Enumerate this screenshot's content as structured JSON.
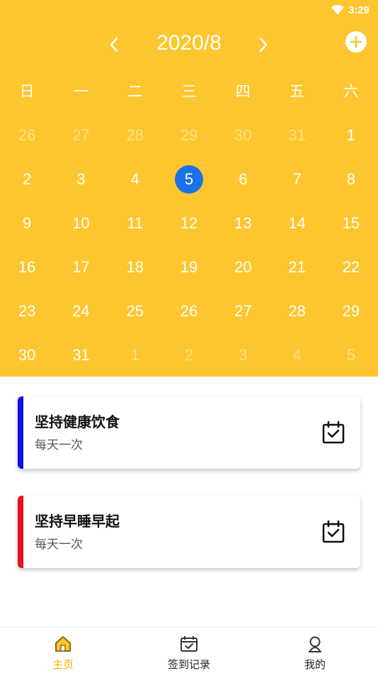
{
  "status_bar": {
    "time": "3:29"
  },
  "calendar": {
    "month_title": "2020/8",
    "weekdays": [
      "日",
      "一",
      "二",
      "三",
      "四",
      "五",
      "六"
    ],
    "days": [
      {
        "label": "26",
        "other": true
      },
      {
        "label": "27",
        "other": true
      },
      {
        "label": "28",
        "other": true
      },
      {
        "label": "29",
        "other": true
      },
      {
        "label": "30",
        "other": true
      },
      {
        "label": "31",
        "other": true
      },
      {
        "label": "1",
        "other": false
      },
      {
        "label": "2",
        "other": false
      },
      {
        "label": "3",
        "other": false
      },
      {
        "label": "4",
        "other": false
      },
      {
        "label": "5",
        "other": false,
        "selected": true
      },
      {
        "label": "6",
        "other": false
      },
      {
        "label": "7",
        "other": false
      },
      {
        "label": "8",
        "other": false
      },
      {
        "label": "9",
        "other": false
      },
      {
        "label": "10",
        "other": false
      },
      {
        "label": "11",
        "other": false
      },
      {
        "label": "12",
        "other": false
      },
      {
        "label": "13",
        "other": false
      },
      {
        "label": "14",
        "other": false
      },
      {
        "label": "15",
        "other": false
      },
      {
        "label": "16",
        "other": false
      },
      {
        "label": "17",
        "other": false
      },
      {
        "label": "18",
        "other": false
      },
      {
        "label": "19",
        "other": false
      },
      {
        "label": "20",
        "other": false
      },
      {
        "label": "21",
        "other": false
      },
      {
        "label": "22",
        "other": false
      },
      {
        "label": "23",
        "other": false
      },
      {
        "label": "24",
        "other": false
      },
      {
        "label": "25",
        "other": false
      },
      {
        "label": "26",
        "other": false
      },
      {
        "label": "27",
        "other": false
      },
      {
        "label": "28",
        "other": false
      },
      {
        "label": "29",
        "other": false
      },
      {
        "label": "30",
        "other": false
      },
      {
        "label": "31",
        "other": false
      },
      {
        "label": "1",
        "other": true
      },
      {
        "label": "2",
        "other": true
      },
      {
        "label": "3",
        "other": true
      },
      {
        "label": "4",
        "other": true
      },
      {
        "label": "5",
        "other": true
      }
    ]
  },
  "habits": [
    {
      "title": "坚持健康饮食",
      "frequency": "每天一次",
      "color": "#1010E8"
    },
    {
      "title": "坚持早睡早起",
      "frequency": "每天一次",
      "color": "#E8101A"
    }
  ],
  "bottom_nav": {
    "items": [
      {
        "label": "主页",
        "icon": "home-icon",
        "active": true
      },
      {
        "label": "签到记录",
        "icon": "calendar-check-icon",
        "active": false
      },
      {
        "label": "我的",
        "icon": "user-icon",
        "active": false
      }
    ]
  },
  "colors": {
    "header_bg": "#FEC62E",
    "accent": "#F5B300",
    "selected_day": "#1A73E8"
  }
}
